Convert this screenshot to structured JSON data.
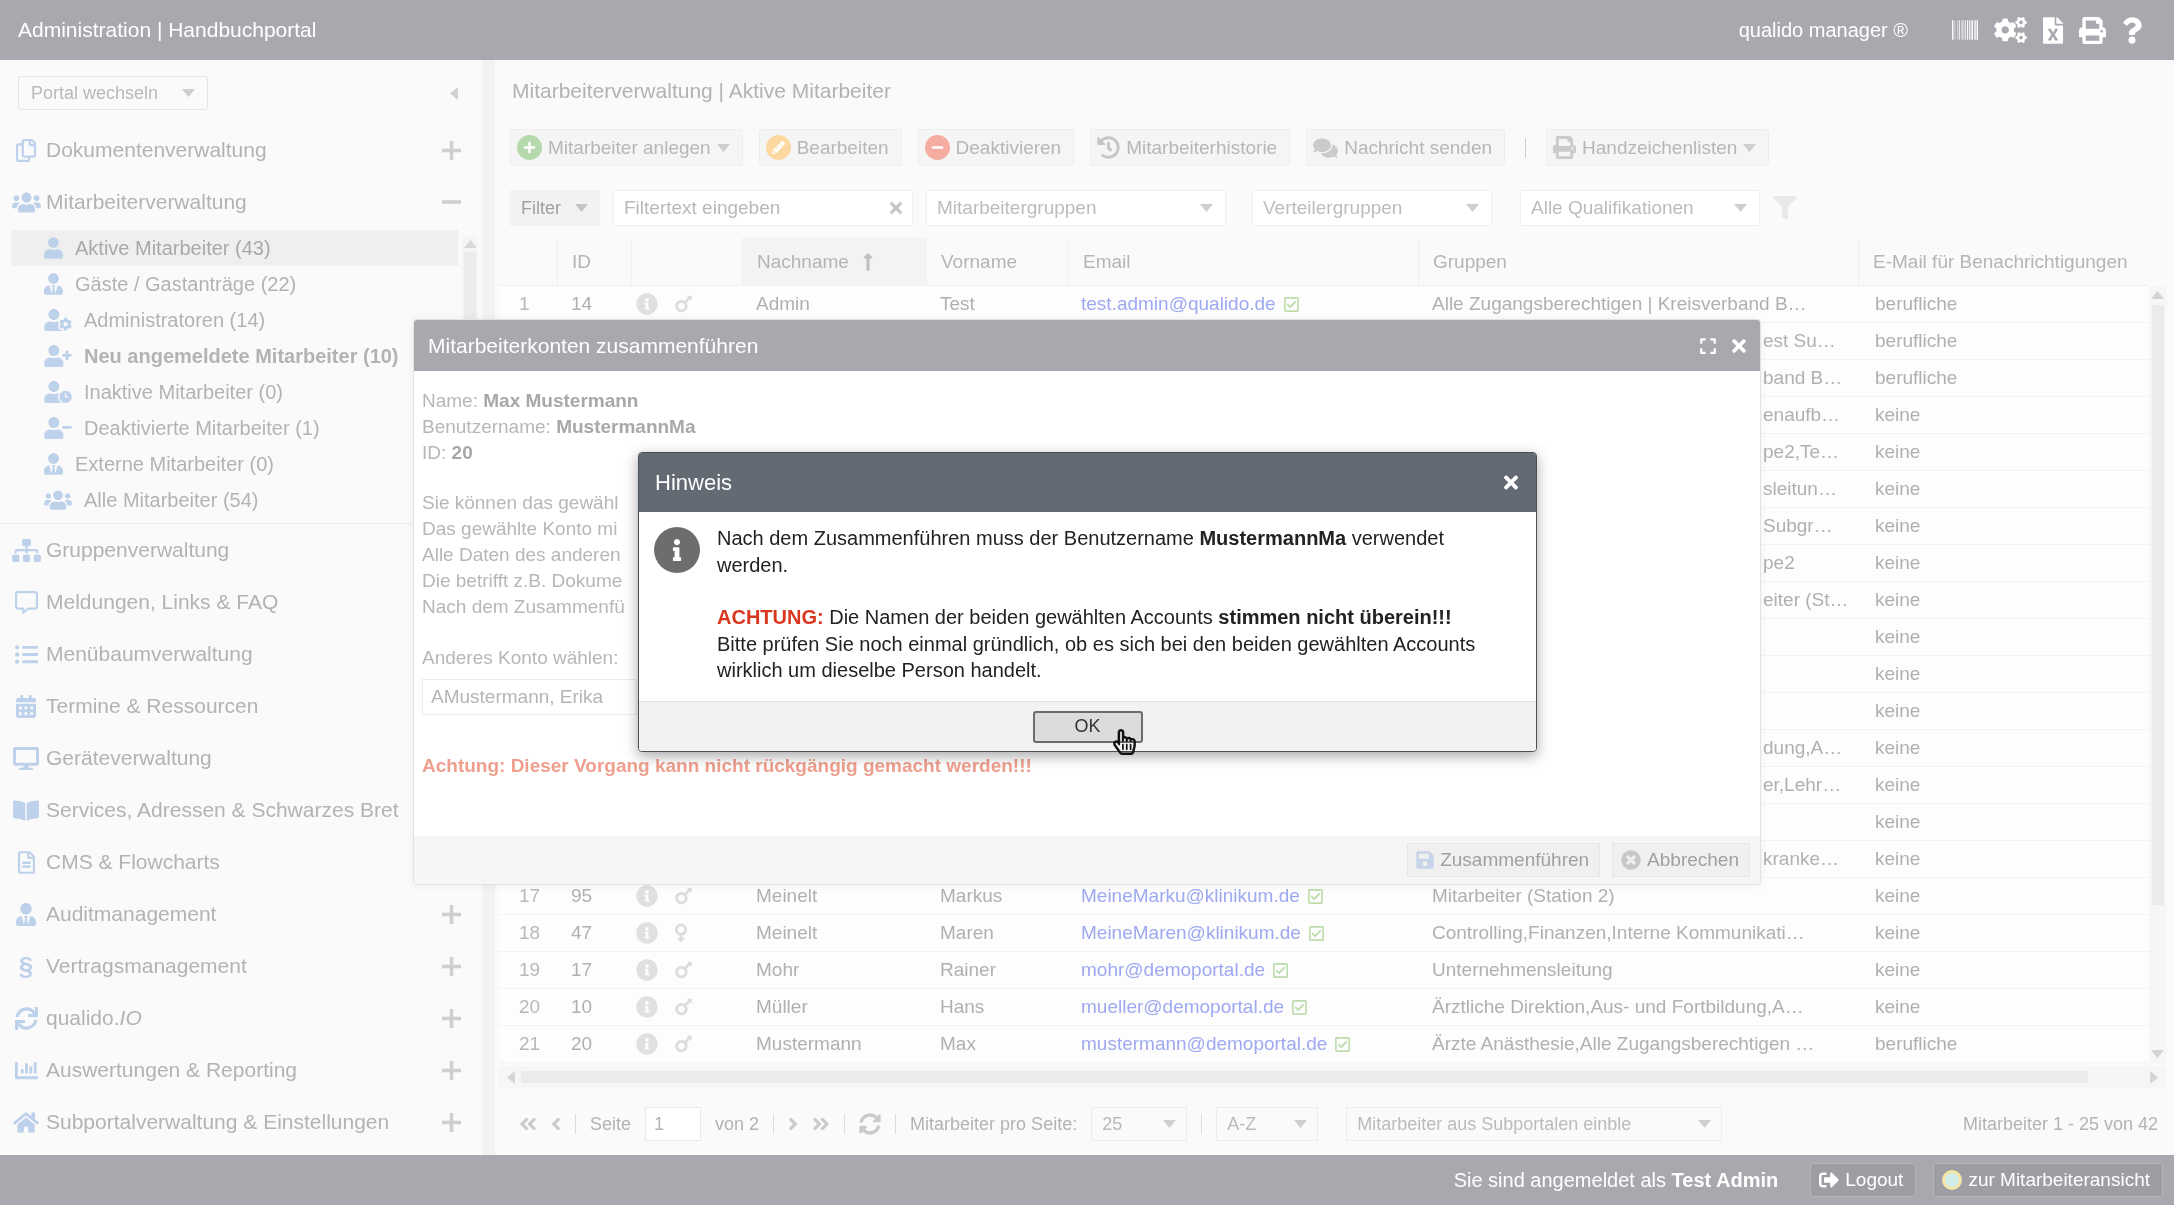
{
  "header": {
    "title": "Administration | Handbuchportal",
    "product": "qualido manager ®"
  },
  "sidebar": {
    "portal_switch": "Portal wechseln",
    "sections": [
      {
        "label": "Dokumentenverwaltung",
        "expanded": false
      },
      {
        "label": "Mitarbeiterverwaltung",
        "expanded": true,
        "children": [
          {
            "label": "Aktive Mitarbeiter (43)",
            "selected": true,
            "emphasized": false
          },
          {
            "label": "Gäste / Gastanträge (22)",
            "selected": false,
            "emphasized": false
          },
          {
            "label": "Administratoren (14)",
            "selected": false,
            "emphasized": false
          },
          {
            "label": "Neu angemeldete Mitarbeiter (10)",
            "selected": false,
            "emphasized": true
          },
          {
            "label": "Inaktive Mitarbeiter (0)",
            "selected": false,
            "emphasized": false
          },
          {
            "label": "Deaktivierte Mitarbeiter (1)",
            "selected": false,
            "emphasized": false
          },
          {
            "label": "Externe Mitarbeiter (0)",
            "selected": false,
            "emphasized": false
          },
          {
            "label": "Alle Mitarbeiter (54)",
            "selected": false,
            "emphasized": false
          }
        ]
      },
      {
        "label": "Gruppenverwaltung"
      },
      {
        "label": "Meldungen, Links & FAQ"
      },
      {
        "label": "Menübaumverwaltung"
      },
      {
        "label": "Termine & Ressourcen"
      },
      {
        "label": "Geräteverwaltung"
      },
      {
        "label": "Services, Adressen & Schwarzes Bret"
      },
      {
        "label": "CMS & Flowcharts"
      },
      {
        "label": "Auditmanagement",
        "expanded": false
      },
      {
        "label": "Vertragsmanagement",
        "glyph": "§",
        "expanded": false
      },
      {
        "label": "qualido.*IO*",
        "expanded": false
      },
      {
        "label": "Auswertungen & Reporting",
        "expanded": false
      },
      {
        "label": "Subportalverwaltung & Einstellungen",
        "expanded": false
      }
    ]
  },
  "main": {
    "title": "Mitarbeiterverwaltung | Aktive Mitarbeiter",
    "toolbar": [
      {
        "label": "Mitarbeiter anlegen",
        "dropdown": true,
        "separator_before": false
      },
      {
        "label": "Bearbeiten",
        "dropdown": false,
        "separator_before": false
      },
      {
        "label": "Deaktivieren",
        "dropdown": false,
        "separator_before": false
      },
      {
        "label": "Mitarbeiterhistorie",
        "dropdown": false,
        "separator_before": false
      },
      {
        "label": "Nachricht senden",
        "dropdown": false,
        "separator_before": false
      },
      {
        "label": "Handzeichenlisten",
        "dropdown": true,
        "separator_before": true
      }
    ],
    "filter": {
      "button": "Filter",
      "search": {
        "placeholder": "Filtertext eingeben"
      },
      "selects": [
        {
          "value": "Mitarbeitergruppen"
        },
        {
          "value": "Verteilergruppen"
        },
        {
          "value": "Alle Qualifikationen"
        }
      ]
    },
    "table": {
      "columns": [
        {
          "sorted": false
        },
        {
          "label": "ID",
          "sorted": false
        },
        {
          "sorted": false
        },
        {
          "label": "Nachname",
          "sorted": true
        },
        {
          "label": "Vorname",
          "sorted": false
        },
        {
          "label": "Email",
          "sorted": false
        },
        {
          "label": "Gruppen",
          "sorted": false
        },
        {
          "label": "E-Mail für Benachrichtigungen",
          "sorted": false
        }
      ],
      "rows": [
        {
          "kind": "full",
          "number": "1",
          "id": "14",
          "female": false,
          "last_name": "Admin",
          "first_name": "Test",
          "email": "test.admin@qualido.de",
          "verified": true,
          "groups": "Alle Zugangsberechtigen | Kreisverband B…",
          "notification": "berufliche"
        },
        {
          "kind": "covered",
          "groups": "est Su…",
          "notification": "berufliche"
        },
        {
          "kind": "covered",
          "groups": "band B…",
          "notification": "berufliche"
        },
        {
          "kind": "covered",
          "groups": "enaufb…",
          "notification": "keine"
        },
        {
          "kind": "covered",
          "groups": "pe2,Te…",
          "notification": "keine"
        },
        {
          "kind": "covered",
          "groups": "sleitun…",
          "notification": "keine"
        },
        {
          "kind": "covered",
          "groups": "Subgr…",
          "notification": "keine"
        },
        {
          "kind": "covered",
          "groups": "pe2",
          "notification": "keine"
        },
        {
          "kind": "covered",
          "groups": "eiter (St…",
          "notification": "keine"
        },
        {
          "kind": "covered",
          "notification": "keine"
        },
        {
          "kind": "covered",
          "notification": "keine"
        },
        {
          "kind": "covered",
          "notification": "keine"
        },
        {
          "kind": "covered",
          "groups": "dung,A…",
          "notification": "keine"
        },
        {
          "kind": "covered",
          "groups": "er,Lehr…",
          "notification": "keine"
        },
        {
          "kind": "covered",
          "notification": "keine"
        },
        {
          "kind": "covered",
          "groups": "kranke…",
          "notification": "keine"
        },
        {
          "kind": "full",
          "number": "17",
          "id": "95",
          "female": false,
          "last_name": "Meinelt",
          "first_name": "Markus",
          "email": "MeineMarku@klinikum.de",
          "verified": true,
          "groups": "Mitarbeiter (Station 2)",
          "notification": "keine"
        },
        {
          "kind": "full",
          "number": "18",
          "id": "47",
          "female": true,
          "last_name": "Meinelt",
          "first_name": "Maren",
          "email": "MeineMaren@klinikum.de",
          "verified": true,
          "groups": "Controlling,Finanzen,Interne Kommunikati…",
          "notification": "keine"
        },
        {
          "kind": "full",
          "number": "19",
          "id": "17",
          "female": false,
          "last_name": "Mohr",
          "first_name": "Rainer",
          "email": "mohr@demoportal.de",
          "verified": true,
          "groups": "Unternehmensleitung",
          "notification": "keine"
        },
        {
          "kind": "full",
          "number": "20",
          "id": "10",
          "female": false,
          "last_name": "Müller",
          "first_name": "Hans",
          "email": "mueller@demoportal.de",
          "verified": true,
          "groups": "Ärztliche Direktion,Aus- und Fortbildung,A…",
          "notification": "keine"
        },
        {
          "kind": "full",
          "number": "21",
          "id": "20",
          "female": false,
          "last_name": "Mustermann",
          "first_name": "Max",
          "email": "mustermann@demoportal.de",
          "verified": true,
          "groups": "Ärzte Anästhesie,Alle Zugangsberechtigen …",
          "notification": "berufliche"
        }
      ]
    },
    "pagination": {
      "page_label": "Seite",
      "page": "1",
      "of": "von 2",
      "per_page_label": "Mitarbeiter pro Seite:",
      "per_page": "25",
      "sort": "A-Z",
      "subportals": "Mitarbeiter aus Subportalen einble",
      "summary": "Mitarbeiter 1 - 25 von 42"
    }
  },
  "footer": {
    "login_text": "Sie sind angemeldet als **Test Admin**",
    "buttons": [
      "Logout",
      "zur Mitarbeiteransicht"
    ]
  },
  "merge_dialog": {
    "title": "Mitarbeiterkonten zusammenführen",
    "details": [
      "Name: **Max Mustermann**",
      "Benutzername: **MustermannMa**",
      "ID: **20**"
    ],
    "intro_lines": [
      "Sie können das gewähl",
      "Das gewählte Konto mi",
      "Alle Daten des anderen",
      "Die betrifft z.B. Dokume",
      "Nach dem Zusammenfü"
    ],
    "account_label": "Anderes Konto wählen:",
    "account_value": "AMustermann, Erika",
    "warning": "Achtung: Dieser Vorgang kann nicht rückgängig gemacht werden!!!",
    "buttons": [
      "Zusammenführen",
      "Abbrechen"
    ]
  },
  "notice_dialog": {
    "title": "Hinweis",
    "message": "Nach dem Zusammenführen muss der Benutzername **MustermannMa** verwendet werden.",
    "warning_lines": [
      "**ACHTUNG:** Die Namen der beiden gewählten Accounts **stimmen nicht überein!!!**",
      "Bitte prüfen Sie noch einmal gründlich, ob es sich bei den beiden gewählten Accounts wirklich um dieselbe Person handelt."
    ],
    "button": "OK"
  }
}
